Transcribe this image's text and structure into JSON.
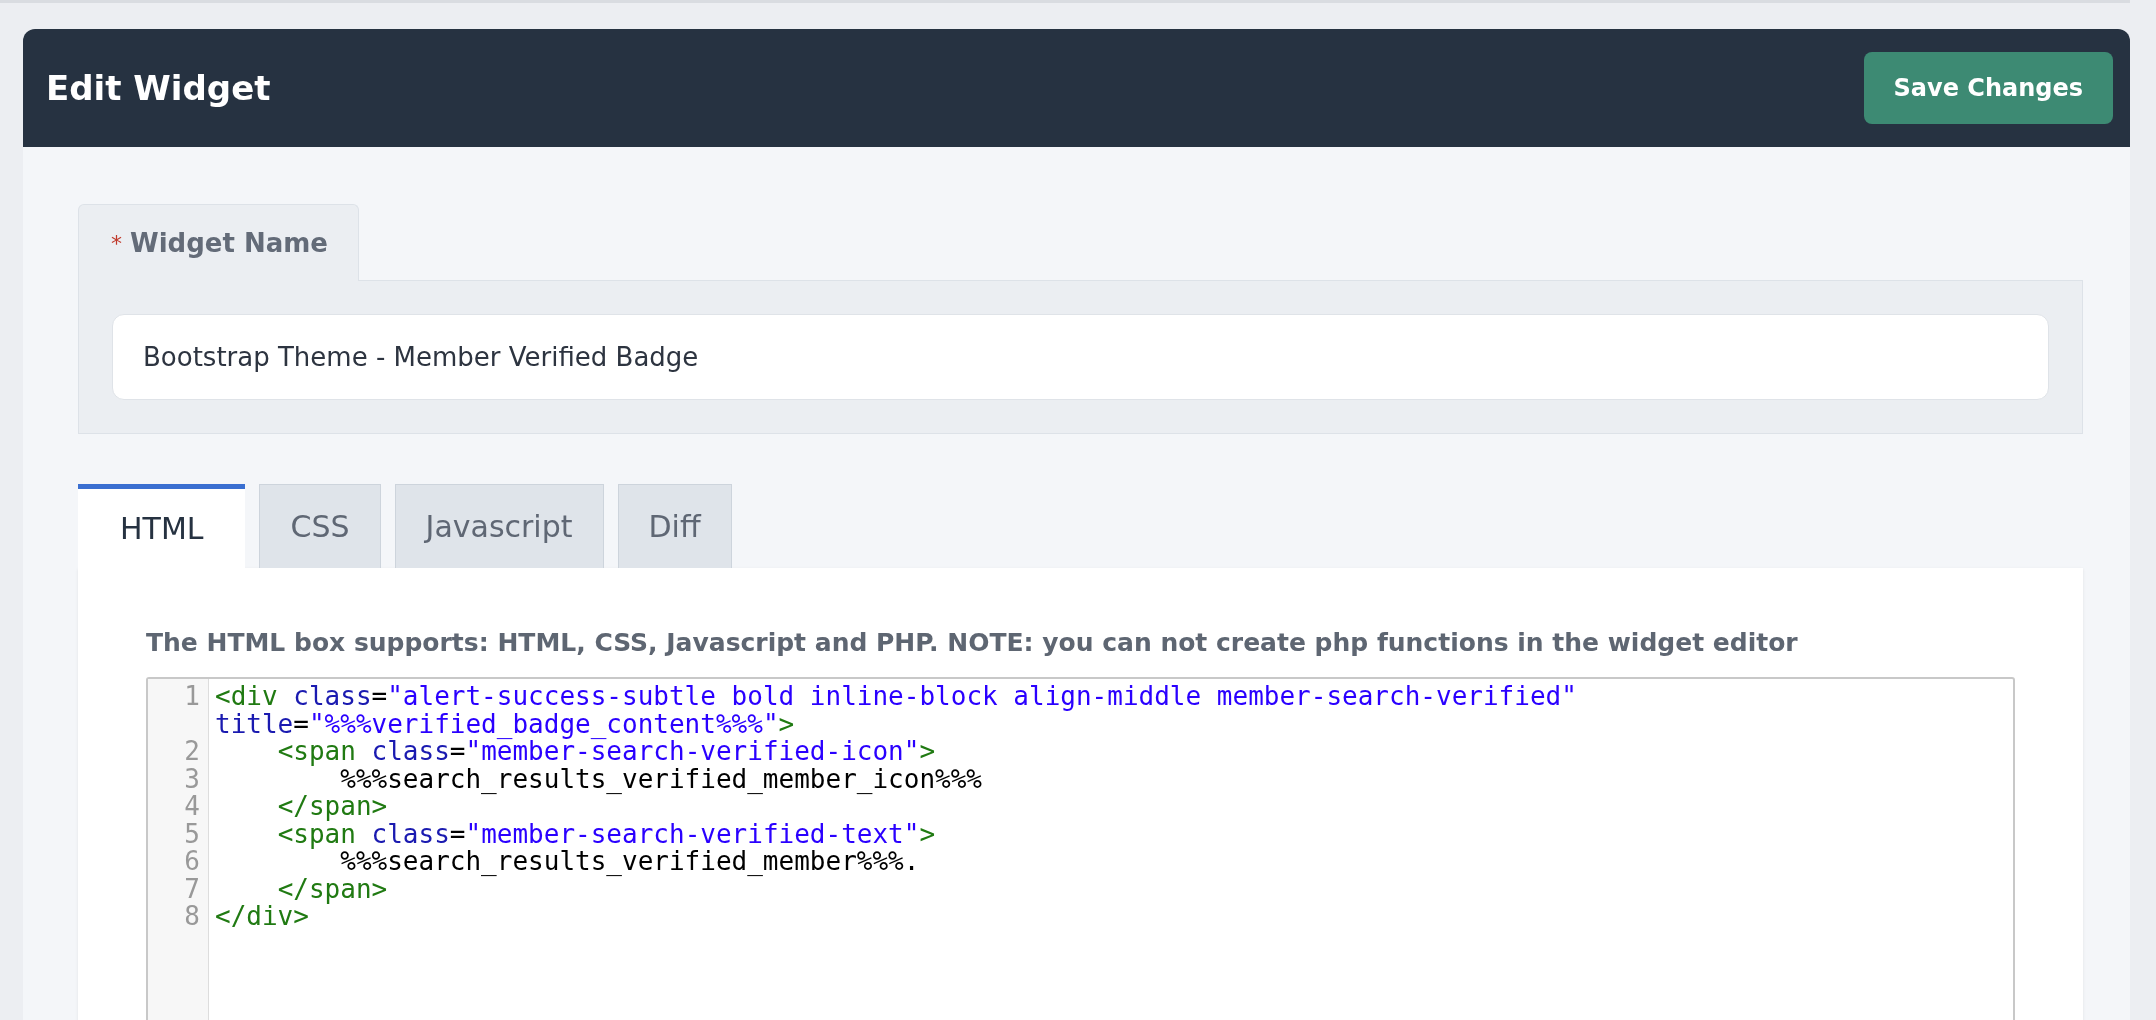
{
  "header": {
    "title": "Edit Widget",
    "save_button": "Save Changes"
  },
  "widget_name": {
    "required_mark": "*",
    "label": "Widget Name",
    "value": "Bootstrap Theme - Member Verified Badge"
  },
  "tabs": [
    {
      "label": "HTML",
      "selected": true
    },
    {
      "label": "CSS",
      "selected": false
    },
    {
      "label": "Javascript",
      "selected": false
    },
    {
      "label": "Diff",
      "selected": false
    }
  ],
  "note": "The HTML box supports: HTML, CSS, Javascript and PHP. NOTE: you can not create php functions in the widget editor",
  "code_lines": [
    {
      "number": "1",
      "tokens": [
        {
          "kind": "tag",
          "text": "<div"
        },
        {
          "kind": "attr",
          "text": " class"
        },
        {
          "kind": "plain",
          "text": "="
        },
        {
          "kind": "string",
          "text": "\"alert-success-subtle bold inline-block align-middle member-search-verified\""
        },
        {
          "kind": "attr",
          "text": " title"
        },
        {
          "kind": "plain",
          "text": "="
        },
        {
          "kind": "string",
          "text": "\"%%%verified_badge_content%%%\""
        },
        {
          "kind": "tag",
          "text": ">"
        }
      ]
    },
    {
      "number": "2",
      "tokens": [
        {
          "kind": "tag",
          "text": "    <span"
        },
        {
          "kind": "attr",
          "text": " class"
        },
        {
          "kind": "plain",
          "text": "="
        },
        {
          "kind": "string",
          "text": "\"member-search-verified-icon\""
        },
        {
          "kind": "tag",
          "text": ">"
        }
      ]
    },
    {
      "number": "3",
      "tokens": [
        {
          "kind": "plain",
          "text": "        %%%search_results_verified_member_icon%%%"
        }
      ]
    },
    {
      "number": "4",
      "tokens": [
        {
          "kind": "tag",
          "text": "    </span>"
        }
      ]
    },
    {
      "number": "5",
      "tokens": [
        {
          "kind": "tag",
          "text": "    <span"
        },
        {
          "kind": "attr",
          "text": " class"
        },
        {
          "kind": "plain",
          "text": "="
        },
        {
          "kind": "string",
          "text": "\"member-search-verified-text\""
        },
        {
          "kind": "tag",
          "text": ">"
        }
      ]
    },
    {
      "number": "6",
      "tokens": [
        {
          "kind": "plain",
          "text": "        %%%search_results_verified_member%%%."
        }
      ]
    },
    {
      "number": "7",
      "tokens": [
        {
          "kind": "tag",
          "text": "    </span>"
        }
      ]
    },
    {
      "number": "8",
      "tokens": [
        {
          "kind": "tag",
          "text": "</div>"
        }
      ]
    }
  ]
}
